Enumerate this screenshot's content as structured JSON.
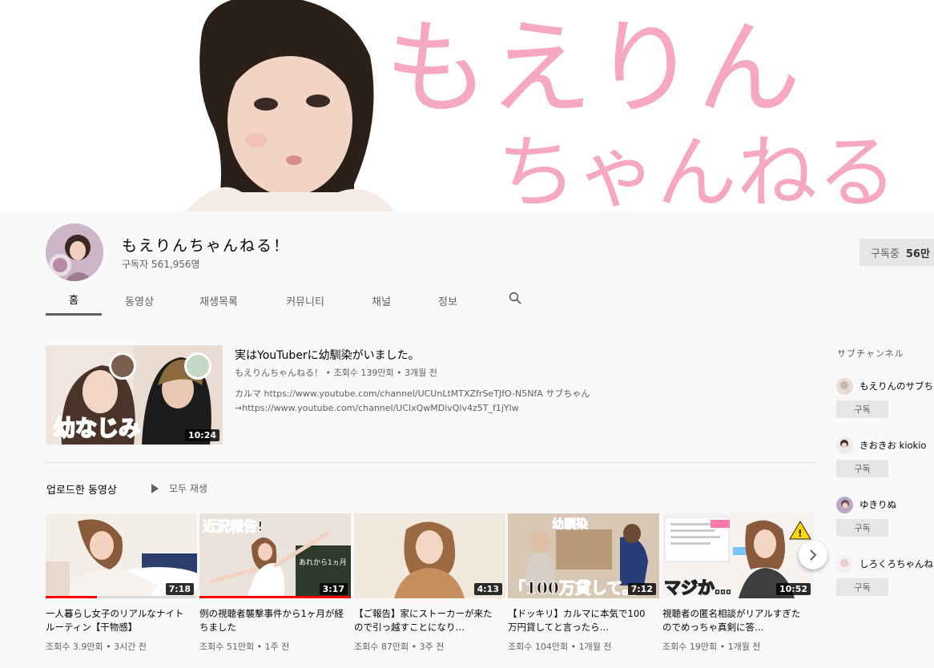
{
  "banner": {
    "logo_line1": "もえりん",
    "logo_line2": "ちゃんねる!",
    "colors": {
      "logo_pink": "#f59ab8"
    }
  },
  "channel": {
    "title": "もえりんちゃんねる！",
    "subscribers": "구독자 561,956명",
    "subscribe_label": "구독중",
    "subscribe_count": "56만"
  },
  "tabs": [
    {
      "label": "홈",
      "active": true
    },
    {
      "label": "동영상"
    },
    {
      "label": "재생목록"
    },
    {
      "label": "커뮤니티"
    },
    {
      "label": "채널"
    },
    {
      "label": "정보"
    }
  ],
  "search_icon": "search-icon",
  "featured": {
    "title": "実はYouTuberに幼馴染がいました。",
    "meta": "もえりんちゃんねる！ • 조회수 139만회 • 3개월 전",
    "desc_line1": "カルマ https://www.youtube.com/channel/UCUnLtMTXZfrSeTJfO-N5NfA サブちゃん",
    "desc_line2": "→https://www.youtube.com/channel/UClxQwMDivQlv4z5T_f1jYlw",
    "thumb_caption": "幼なじみ",
    "duration": "10:24"
  },
  "uploads": {
    "section_title": "업로드한 동영상",
    "play_all": "모두 재생",
    "videos": [
      {
        "title": "一人暮らし女子のリアルなナイトルーティン【干物感】",
        "meta": "조회수 3.9만회 • 3시간 전",
        "duration": "7:18",
        "watched": 0.34,
        "overlay": ""
      },
      {
        "title": "例の視聴者襲撃事件から1ヶ月が経ちました",
        "meta": "조회수 51만회 • 1주 전",
        "duration": "3:17",
        "watched": 1.0,
        "overlay": "近況報告!",
        "overlay2": "あれから1ヵ月"
      },
      {
        "title": "【ご報告】家にストーカーが来たので引っ越すことになり…",
        "meta": "조회수 87만회 • 3주 전",
        "duration": "4:13",
        "watched": 0,
        "overlay": ""
      },
      {
        "title": "【ドッキリ】カルマに本気で100万円貸してと言ったら…",
        "meta": "조회수 104만회 • 1개월 전",
        "duration": "7:12",
        "watched": 0,
        "overlay": "幼馴染",
        "overlay2": "「100万貸して。」"
      },
      {
        "title": "視聴者の匿名相談がリアルすぎたのでめっちゃ真剣に答…",
        "meta": "조회수 19만회 • 1개월 전",
        "duration": "10:52",
        "watched": 0,
        "overlay": "マジか…"
      }
    ]
  },
  "sidebar": {
    "title": "サブチャンネル",
    "channels": [
      {
        "name": "もえりんのサブちゃん",
        "button": "구독"
      },
      {
        "name": "きおきお kiokio",
        "button": "구독"
      },
      {
        "name": "ゆきりぬ",
        "button": "구독"
      },
      {
        "name": "しろくろちゃんねる",
        "button": "구독"
      }
    ]
  }
}
